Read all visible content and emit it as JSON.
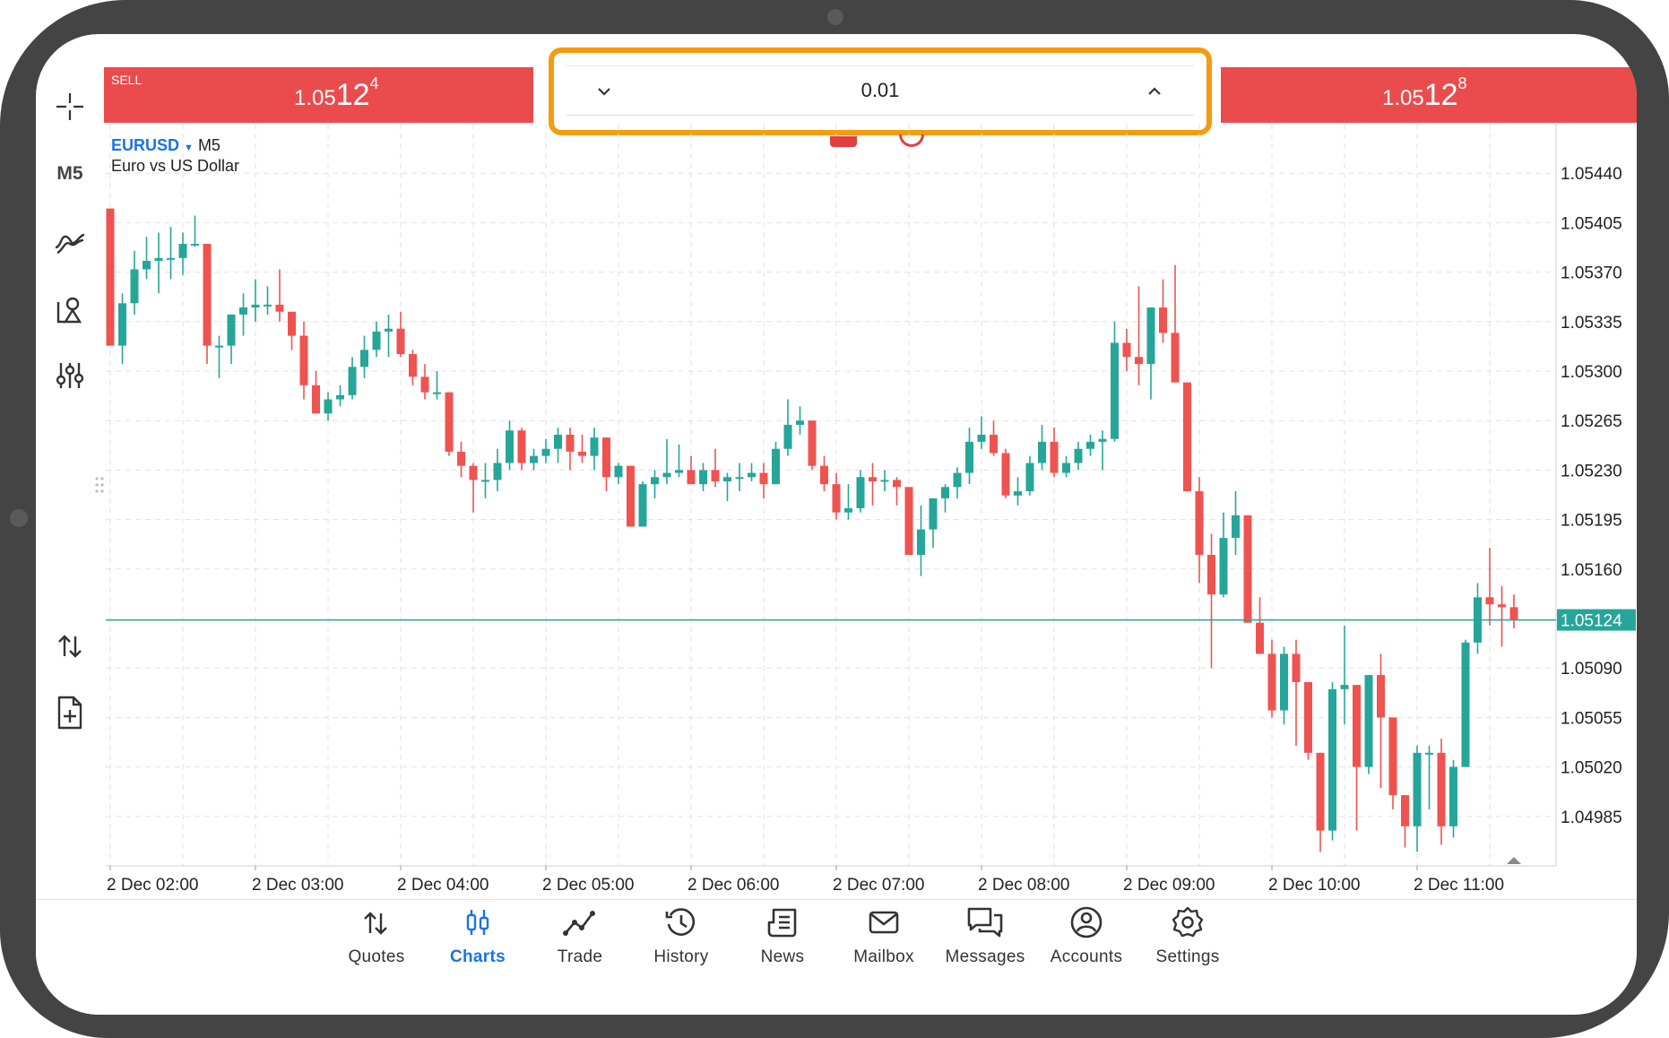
{
  "trade_panel": {
    "sell_label": "SELL",
    "sell_price": {
      "prefix": "1.05",
      "big": "12",
      "sup": "4"
    },
    "buy_price": {
      "prefix": "1.05",
      "big": "12",
      "sup": "8"
    },
    "volume_value": "0.01"
  },
  "chart_header": {
    "symbol": "EURUSD",
    "timeframe": "M5",
    "description": "Euro vs US Dollar"
  },
  "left_toolbar": {
    "timeframe_label": "M5",
    "tools": [
      "crosshair-icon",
      "timeframe",
      "indicators-icon",
      "objects-icon",
      "settings-sliders-icon",
      "trade-arrows-icon",
      "new-order-icon"
    ]
  },
  "colors": {
    "bull": "#26a69a",
    "bear": "#ef5350",
    "sell_bar": "#ea4c4e",
    "highlight": "#f39c12",
    "accent": "#1a73e8",
    "current_price_line": "#26a69a"
  },
  "chart_data": {
    "type": "candlestick",
    "symbol": "EURUSD",
    "timeframe": "M5",
    "current_price": 1.05124,
    "ylim": [
      1.0495,
      1.05475
    ],
    "y_ticks": [
      1.0544,
      1.05405,
      1.0537,
      1.05335,
      1.053,
      1.05265,
      1.0523,
      1.05195,
      1.0516,
      1.05124,
      1.0509,
      1.05055,
      1.0502,
      1.04985
    ],
    "y_tick_labels": [
      "1.05440",
      "1.05405",
      "1.05370",
      "1.05335",
      "1.05300",
      "1.05265",
      "1.05230",
      "1.05195",
      "1.05160",
      "1.05124",
      "1.05090",
      "1.05055",
      "1.05020",
      "1.04985"
    ],
    "x_labels": [
      "2 Dec 02:00",
      "2 Dec 03:00",
      "2 Dec 04:00",
      "2 Dec 05:00",
      "2 Dec 06:00",
      "2 Dec 07:00",
      "2 Dec 08:00",
      "2 Dec 09:00",
      "2 Dec 10:00",
      "2 Dec 11:00"
    ],
    "x_label_candle_index": [
      0,
      12,
      24,
      36,
      48,
      60,
      72,
      84,
      96,
      108
    ],
    "candles": [
      {
        "o": 1.05415,
        "h": 1.05415,
        "l": 1.05318,
        "c": 1.05318
      },
      {
        "o": 1.05318,
        "h": 1.05355,
        "l": 1.05305,
        "c": 1.05348
      },
      {
        "o": 1.05348,
        "h": 1.05385,
        "l": 1.0534,
        "c": 1.05372
      },
      {
        "o": 1.05372,
        "h": 1.05395,
        "l": 1.05365,
        "c": 1.05378
      },
      {
        "o": 1.05378,
        "h": 1.05398,
        "l": 1.05355,
        "c": 1.0538
      },
      {
        "o": 1.0538,
        "h": 1.05402,
        "l": 1.05365,
        "c": 1.0538
      },
      {
        "o": 1.0538,
        "h": 1.05398,
        "l": 1.05368,
        "c": 1.0539
      },
      {
        "o": 1.0539,
        "h": 1.0541,
        "l": 1.05388,
        "c": 1.0539
      },
      {
        "o": 1.0539,
        "h": 1.0539,
        "l": 1.05305,
        "c": 1.05318
      },
      {
        "o": 1.05318,
        "h": 1.05325,
        "l": 1.05295,
        "c": 1.05318
      },
      {
        "o": 1.05318,
        "h": 1.0534,
        "l": 1.05305,
        "c": 1.0534
      },
      {
        "o": 1.0534,
        "h": 1.05355,
        "l": 1.05325,
        "c": 1.05345
      },
      {
        "o": 1.05345,
        "h": 1.05365,
        "l": 1.05335,
        "c": 1.05347
      },
      {
        "o": 1.05347,
        "h": 1.0536,
        "l": 1.0534,
        "c": 1.05347
      },
      {
        "o": 1.05347,
        "h": 1.05372,
        "l": 1.05335,
        "c": 1.05342
      },
      {
        "o": 1.05342,
        "h": 1.05342,
        "l": 1.05315,
        "c": 1.05325
      },
      {
        "o": 1.05325,
        "h": 1.05335,
        "l": 1.0528,
        "c": 1.0529
      },
      {
        "o": 1.0529,
        "h": 1.053,
        "l": 1.0527,
        "c": 1.0527
      },
      {
        "o": 1.0527,
        "h": 1.05285,
        "l": 1.05265,
        "c": 1.0528
      },
      {
        "o": 1.0528,
        "h": 1.0529,
        "l": 1.05275,
        "c": 1.05283
      },
      {
        "o": 1.05283,
        "h": 1.0531,
        "l": 1.0528,
        "c": 1.05303
      },
      {
        "o": 1.05303,
        "h": 1.05325,
        "l": 1.05295,
        "c": 1.05315
      },
      {
        "o": 1.05315,
        "h": 1.05335,
        "l": 1.0531,
        "c": 1.05328
      },
      {
        "o": 1.05328,
        "h": 1.0534,
        "l": 1.0531,
        "c": 1.0533
      },
      {
        "o": 1.0533,
        "h": 1.05342,
        "l": 1.0531,
        "c": 1.05312
      },
      {
        "o": 1.05312,
        "h": 1.05315,
        "l": 1.0529,
        "c": 1.05296
      },
      {
        "o": 1.05296,
        "h": 1.05305,
        "l": 1.0528,
        "c": 1.05285
      },
      {
        "o": 1.05285,
        "h": 1.053,
        "l": 1.0528,
        "c": 1.05285
      },
      {
        "o": 1.05285,
        "h": 1.05285,
        "l": 1.0524,
        "c": 1.05243
      },
      {
        "o": 1.05243,
        "h": 1.0525,
        "l": 1.05225,
        "c": 1.05233
      },
      {
        "o": 1.05233,
        "h": 1.05235,
        "l": 1.052,
        "c": 1.05223
      },
      {
        "o": 1.05223,
        "h": 1.05235,
        "l": 1.0521,
        "c": 1.05223
      },
      {
        "o": 1.05223,
        "h": 1.05245,
        "l": 1.05215,
        "c": 1.05235
      },
      {
        "o": 1.05235,
        "h": 1.05265,
        "l": 1.0523,
        "c": 1.05258
      },
      {
        "o": 1.05258,
        "h": 1.0526,
        "l": 1.0523,
        "c": 1.05235
      },
      {
        "o": 1.05235,
        "h": 1.05245,
        "l": 1.0523,
        "c": 1.0524
      },
      {
        "o": 1.0524,
        "h": 1.05252,
        "l": 1.05235,
        "c": 1.05245
      },
      {
        "o": 1.05245,
        "h": 1.0526,
        "l": 1.05235,
        "c": 1.05255
      },
      {
        "o": 1.05255,
        "h": 1.0526,
        "l": 1.0523,
        "c": 1.05243
      },
      {
        "o": 1.05243,
        "h": 1.05255,
        "l": 1.05235,
        "c": 1.0524
      },
      {
        "o": 1.0524,
        "h": 1.0526,
        "l": 1.0523,
        "c": 1.05253
      },
      {
        "o": 1.05253,
        "h": 1.05253,
        "l": 1.05215,
        "c": 1.05225
      },
      {
        "o": 1.05225,
        "h": 1.05235,
        "l": 1.0522,
        "c": 1.05233
      },
      {
        "o": 1.05233,
        "h": 1.05233,
        "l": 1.0519,
        "c": 1.0519
      },
      {
        "o": 1.0519,
        "h": 1.05222,
        "l": 1.0519,
        "c": 1.0522
      },
      {
        "o": 1.0522,
        "h": 1.0523,
        "l": 1.0521,
        "c": 1.05225
      },
      {
        "o": 1.05225,
        "h": 1.05252,
        "l": 1.0522,
        "c": 1.05228
      },
      {
        "o": 1.05228,
        "h": 1.05248,
        "l": 1.05225,
        "c": 1.0523
      },
      {
        "o": 1.0523,
        "h": 1.0524,
        "l": 1.0522,
        "c": 1.0522
      },
      {
        "o": 1.0522,
        "h": 1.05235,
        "l": 1.05215,
        "c": 1.0523
      },
      {
        "o": 1.0523,
        "h": 1.05245,
        "l": 1.05218,
        "c": 1.05222
      },
      {
        "o": 1.05222,
        "h": 1.05228,
        "l": 1.05208,
        "c": 1.05225
      },
      {
        "o": 1.05225,
        "h": 1.05235,
        "l": 1.05215,
        "c": 1.05225
      },
      {
        "o": 1.05225,
        "h": 1.05235,
        "l": 1.05222,
        "c": 1.05228
      },
      {
        "o": 1.05228,
        "h": 1.05235,
        "l": 1.0521,
        "c": 1.0522
      },
      {
        "o": 1.0522,
        "h": 1.0525,
        "l": 1.0522,
        "c": 1.05245
      },
      {
        "o": 1.05245,
        "h": 1.0528,
        "l": 1.0524,
        "c": 1.05262
      },
      {
        "o": 1.05262,
        "h": 1.05275,
        "l": 1.05255,
        "c": 1.05265
      },
      {
        "o": 1.05265,
        "h": 1.05265,
        "l": 1.0523,
        "c": 1.05233
      },
      {
        "o": 1.05233,
        "h": 1.0524,
        "l": 1.05215,
        "c": 1.0522
      },
      {
        "o": 1.0522,
        "h": 1.05228,
        "l": 1.05195,
        "c": 1.052
      },
      {
        "o": 1.052,
        "h": 1.0522,
        "l": 1.05195,
        "c": 1.05203
      },
      {
        "o": 1.05203,
        "h": 1.0523,
        "l": 1.052,
        "c": 1.05225
      },
      {
        "o": 1.05225,
        "h": 1.05235,
        "l": 1.05205,
        "c": 1.05222
      },
      {
        "o": 1.05222,
        "h": 1.0523,
        "l": 1.05215,
        "c": 1.05223
      },
      {
        "o": 1.05223,
        "h": 1.05225,
        "l": 1.05205,
        "c": 1.05218
      },
      {
        "o": 1.05218,
        "h": 1.05218,
        "l": 1.0517,
        "c": 1.0517
      },
      {
        "o": 1.0517,
        "h": 1.05205,
        "l": 1.05155,
        "c": 1.05188
      },
      {
        "o": 1.05188,
        "h": 1.0521,
        "l": 1.05175,
        "c": 1.0521
      },
      {
        "o": 1.0521,
        "h": 1.0522,
        "l": 1.052,
        "c": 1.05218
      },
      {
        "o": 1.05218,
        "h": 1.05232,
        "l": 1.0521,
        "c": 1.05228
      },
      {
        "o": 1.05228,
        "h": 1.0526,
        "l": 1.0522,
        "c": 1.0525
      },
      {
        "o": 1.0525,
        "h": 1.05268,
        "l": 1.05245,
        "c": 1.05255
      },
      {
        "o": 1.05255,
        "h": 1.05265,
        "l": 1.0524,
        "c": 1.05242
      },
      {
        "o": 1.05242,
        "h": 1.05245,
        "l": 1.0521,
        "c": 1.05212
      },
      {
        "o": 1.05212,
        "h": 1.05225,
        "l": 1.05205,
        "c": 1.05215
      },
      {
        "o": 1.05215,
        "h": 1.0524,
        "l": 1.05212,
        "c": 1.05235
      },
      {
        "o": 1.05235,
        "h": 1.05262,
        "l": 1.0523,
        "c": 1.0525
      },
      {
        "o": 1.0525,
        "h": 1.0526,
        "l": 1.05225,
        "c": 1.05228
      },
      {
        "o": 1.05228,
        "h": 1.0524,
        "l": 1.05225,
        "c": 1.05235
      },
      {
        "o": 1.05235,
        "h": 1.0525,
        "l": 1.0523,
        "c": 1.05245
      },
      {
        "o": 1.05245,
        "h": 1.05255,
        "l": 1.0524,
        "c": 1.0525
      },
      {
        "o": 1.0525,
        "h": 1.05258,
        "l": 1.0523,
        "c": 1.05252
      },
      {
        "o": 1.05252,
        "h": 1.05335,
        "l": 1.0525,
        "c": 1.0532
      },
      {
        "o": 1.0532,
        "h": 1.0533,
        "l": 1.053,
        "c": 1.0531
      },
      {
        "o": 1.0531,
        "h": 1.0536,
        "l": 1.0529,
        "c": 1.05305
      },
      {
        "o": 1.05305,
        "h": 1.05345,
        "l": 1.0528,
        "c": 1.05345
      },
      {
        "o": 1.05345,
        "h": 1.05365,
        "l": 1.0532,
        "c": 1.05327
      },
      {
        "o": 1.05327,
        "h": 1.05375,
        "l": 1.05295,
        "c": 1.05292
      },
      {
        "o": 1.05292,
        "h": 1.05292,
        "l": 1.05215,
        "c": 1.05215
      },
      {
        "o": 1.05215,
        "h": 1.05225,
        "l": 1.0515,
        "c": 1.0517
      },
      {
        "o": 1.0517,
        "h": 1.05185,
        "l": 1.0509,
        "c": 1.05142
      },
      {
        "o": 1.05142,
        "h": 1.052,
        "l": 1.0514,
        "c": 1.05182
      },
      {
        "o": 1.05182,
        "h": 1.05215,
        "l": 1.0517,
        "c": 1.05198
      },
      {
        "o": 1.05198,
        "h": 1.05198,
        "l": 1.05122,
        "c": 1.05122
      },
      {
        "o": 1.05122,
        "h": 1.0514,
        "l": 1.051,
        "c": 1.051
      },
      {
        "o": 1.051,
        "h": 1.0511,
        "l": 1.05055,
        "c": 1.0506
      },
      {
        "o": 1.0506,
        "h": 1.05105,
        "l": 1.0505,
        "c": 1.051
      },
      {
        "o": 1.051,
        "h": 1.0511,
        "l": 1.05035,
        "c": 1.0508
      },
      {
        "o": 1.0508,
        "h": 1.0508,
        "l": 1.05025,
        "c": 1.0503
      },
      {
        "o": 1.0503,
        "h": 1.0503,
        "l": 1.0496,
        "c": 1.04975
      },
      {
        "o": 1.04975,
        "h": 1.0508,
        "l": 1.04968,
        "c": 1.05075
      },
      {
        "o": 1.05075,
        "h": 1.0512,
        "l": 1.0505,
        "c": 1.05078
      },
      {
        "o": 1.05078,
        "h": 1.05078,
        "l": 1.04975,
        "c": 1.0502
      },
      {
        "o": 1.0502,
        "h": 1.05085,
        "l": 1.05015,
        "c": 1.05085
      },
      {
        "o": 1.05085,
        "h": 1.051,
        "l": 1.05005,
        "c": 1.05055
      },
      {
        "o": 1.05055,
        "h": 1.05055,
        "l": 1.0499,
        "c": 1.05
      },
      {
        "o": 1.05,
        "h": 1.05,
        "l": 1.04963,
        "c": 1.04978
      },
      {
        "o": 1.04978,
        "h": 1.05035,
        "l": 1.0496,
        "c": 1.0503
      },
      {
        "o": 1.0503,
        "h": 1.05035,
        "l": 1.0499,
        "c": 1.0503
      },
      {
        "o": 1.0503,
        "h": 1.0504,
        "l": 1.04965,
        "c": 1.04978
      },
      {
        "o": 1.04978,
        "h": 1.05025,
        "l": 1.0497,
        "c": 1.0502
      },
      {
        "o": 1.0502,
        "h": 1.0511,
        "l": 1.0502,
        "c": 1.05108
      },
      {
        "o": 1.05108,
        "h": 1.0515,
        "l": 1.051,
        "c": 1.0514
      },
      {
        "o": 1.0514,
        "h": 1.05175,
        "l": 1.0512,
        "c": 1.05135
      },
      {
        "o": 1.05135,
        "h": 1.05148,
        "l": 1.05105,
        "c": 1.05133
      },
      {
        "o": 1.05133,
        "h": 1.05142,
        "l": 1.05118,
        "c": 1.05124
      }
    ]
  },
  "nav": [
    {
      "label": "Quotes",
      "icon": "quotes-icon"
    },
    {
      "label": "Charts",
      "icon": "charts-icon",
      "active": true
    },
    {
      "label": "Trade",
      "icon": "trade-icon"
    },
    {
      "label": "History",
      "icon": "history-icon"
    },
    {
      "label": "News",
      "icon": "news-icon"
    },
    {
      "label": "Mailbox",
      "icon": "mailbox-icon"
    },
    {
      "label": "Messages",
      "icon": "messages-icon"
    },
    {
      "label": "Accounts",
      "icon": "accounts-icon"
    },
    {
      "label": "Settings",
      "icon": "settings-icon"
    }
  ]
}
